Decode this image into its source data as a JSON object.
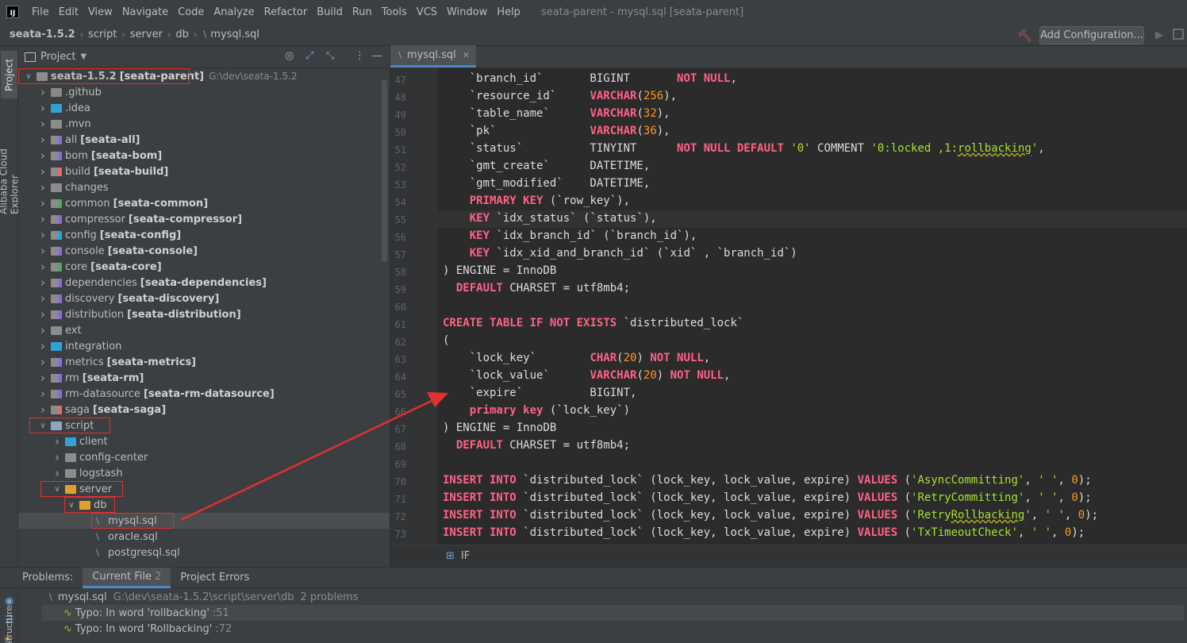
{
  "menubar": {
    "items": [
      "File",
      "Edit",
      "View",
      "Navigate",
      "Code",
      "Analyze",
      "Refactor",
      "Build",
      "Run",
      "Tools",
      "VCS",
      "Window",
      "Help"
    ],
    "window_title": "seata-parent - mysql.sql [seata-parent]"
  },
  "navbar": {
    "breadcrumbs": [
      "seata-1.5.2",
      "script",
      "server",
      "db",
      "mysql.sql"
    ],
    "add_config_label": "Add Configuration..."
  },
  "left_strip": {
    "tabs": [
      "Project",
      "Alibaba Cloud Explorer"
    ]
  },
  "project_panel": {
    "title": "Project",
    "tree": [
      {
        "depth": 0,
        "arrow": "down",
        "icon": "folder",
        "name": "seata-1.5.2",
        "module": "[seata-parent]",
        "hint": "G:\\dev\\seata-1.5.2"
      },
      {
        "depth": 1,
        "arrow": "right",
        "icon": "folder",
        "name": ".github"
      },
      {
        "depth": 1,
        "arrow": "right",
        "icon": "folder",
        "name": ".idea"
      },
      {
        "depth": 1,
        "arrow": "right",
        "icon": "folder",
        "name": ".mvn"
      },
      {
        "depth": 1,
        "arrow": "right",
        "icon": "module",
        "name": "all",
        "module": "[seata-all]"
      },
      {
        "depth": 1,
        "arrow": "right",
        "icon": "module",
        "name": "bom",
        "module": "[seata-bom]"
      },
      {
        "depth": 1,
        "arrow": "right",
        "icon": "module",
        "name": "build",
        "module": "[seata-build]"
      },
      {
        "depth": 1,
        "arrow": "right",
        "icon": "folder",
        "name": "changes"
      },
      {
        "depth": 1,
        "arrow": "right",
        "icon": "module",
        "name": "common",
        "module": "[seata-common]"
      },
      {
        "depth": 1,
        "arrow": "right",
        "icon": "module",
        "name": "compressor",
        "module": "[seata-compressor]"
      },
      {
        "depth": 1,
        "arrow": "right",
        "icon": "module",
        "name": "config",
        "module": "[seata-config]"
      },
      {
        "depth": 1,
        "arrow": "right",
        "icon": "module",
        "name": "console",
        "module": "[seata-console]"
      },
      {
        "depth": 1,
        "arrow": "right",
        "icon": "module",
        "name": "core",
        "module": "[seata-core]"
      },
      {
        "depth": 1,
        "arrow": "right",
        "icon": "module",
        "name": "dependencies",
        "module": "[seata-dependencies]"
      },
      {
        "depth": 1,
        "arrow": "right",
        "icon": "module",
        "name": "discovery",
        "module": "[seata-discovery]"
      },
      {
        "depth": 1,
        "arrow": "right",
        "icon": "module",
        "name": "distribution",
        "module": "[seata-distribution]"
      },
      {
        "depth": 1,
        "arrow": "right",
        "icon": "folder",
        "name": "ext"
      },
      {
        "depth": 1,
        "arrow": "right",
        "icon": "folder",
        "name": "integration"
      },
      {
        "depth": 1,
        "arrow": "right",
        "icon": "module",
        "name": "metrics",
        "module": "[seata-metrics]"
      },
      {
        "depth": 1,
        "arrow": "right",
        "icon": "module",
        "name": "rm",
        "module": "[seata-rm]"
      },
      {
        "depth": 1,
        "arrow": "right",
        "icon": "module",
        "name": "rm-datasource",
        "module": "[seata-rm-datasource]"
      },
      {
        "depth": 1,
        "arrow": "right",
        "icon": "module",
        "name": "saga",
        "module": "[seata-saga]"
      },
      {
        "depth": 1,
        "arrow": "down",
        "icon": "folder",
        "name": "script"
      },
      {
        "depth": 2,
        "arrow": "right",
        "icon": "folder",
        "name": "client"
      },
      {
        "depth": 2,
        "arrow": "right",
        "icon": "folder",
        "name": "config-center"
      },
      {
        "depth": 2,
        "arrow": "right",
        "icon": "folder",
        "name": "logstash"
      },
      {
        "depth": 2,
        "arrow": "down",
        "icon": "folder",
        "name": "server"
      },
      {
        "depth": 3,
        "arrow": "down",
        "icon": "folder",
        "name": "db"
      },
      {
        "depth": 4,
        "arrow": "",
        "icon": "sql",
        "name": "mysql.sql",
        "selected": true
      },
      {
        "depth": 4,
        "arrow": "",
        "icon": "sql",
        "name": "oracle.sql"
      },
      {
        "depth": 4,
        "arrow": "",
        "icon": "sql",
        "name": "postgresql.sql"
      }
    ]
  },
  "editor": {
    "tab_label": "mysql.sql",
    "footer_label": "IF",
    "lines": [
      {
        "n": "47",
        "t": [
          [
            "    `branch_id`       BIGINT       ",
            ""
          ],
          [
            "NOT NULL",
            "kw"
          ],
          [
            ",",
            ""
          ]
        ]
      },
      {
        "n": "48",
        "t": [
          [
            "    `resource_id`     ",
            ""
          ],
          [
            "VARCHAR",
            "kw"
          ],
          [
            "(",
            ""
          ],
          [
            "256",
            "num"
          ],
          [
            "),",
            ""
          ]
        ]
      },
      {
        "n": "49",
        "t": [
          [
            "    `table_name`      ",
            ""
          ],
          [
            "VARCHAR",
            "kw"
          ],
          [
            "(",
            ""
          ],
          [
            "32",
            "num"
          ],
          [
            "),",
            ""
          ]
        ]
      },
      {
        "n": "50",
        "t": [
          [
            "    `pk`              ",
            ""
          ],
          [
            "VARCHAR",
            "kw"
          ],
          [
            "(",
            ""
          ],
          [
            "36",
            "num"
          ],
          [
            "),",
            ""
          ]
        ]
      },
      {
        "n": "51",
        "t": [
          [
            "    `status`          TINYINT      ",
            ""
          ],
          [
            "NOT NULL DEFAULT",
            "kw"
          ],
          [
            " ",
            ""
          ],
          [
            "'0'",
            "str"
          ],
          [
            " COMMENT ",
            ""
          ],
          [
            "'0:locked ,1:",
            "str"
          ],
          [
            "rollbacking",
            "str typo"
          ],
          [
            "'",
            "str"
          ],
          [
            ",",
            ""
          ]
        ]
      },
      {
        "n": "52",
        "t": [
          [
            "    `gmt_create`      DATETIME,",
            ""
          ]
        ]
      },
      {
        "n": "53",
        "t": [
          [
            "    `gmt_modified`    DATETIME,",
            ""
          ]
        ]
      },
      {
        "n": "54",
        "t": [
          [
            "    ",
            ""
          ],
          [
            "PRIMARY KEY",
            "kw"
          ],
          [
            " (`row_key`),",
            ""
          ]
        ]
      },
      {
        "n": "55",
        "t": [
          [
            "    ",
            ""
          ],
          [
            "KEY",
            "kw"
          ],
          [
            " `idx_status` (`status`),",
            ""
          ]
        ]
      },
      {
        "n": "56",
        "t": [
          [
            "    ",
            ""
          ],
          [
            "KEY",
            "kw"
          ],
          [
            " `idx_branch_id` (`branch_id`),",
            ""
          ]
        ]
      },
      {
        "n": "57",
        "t": [
          [
            "    ",
            ""
          ],
          [
            "KEY",
            "kw"
          ],
          [
            " `idx_xid_and_branch_id` (`xid` , `branch_id`)",
            ""
          ]
        ]
      },
      {
        "n": "58",
        "t": [
          [
            ") ENGINE = InnoDB",
            ""
          ]
        ]
      },
      {
        "n": "59",
        "t": [
          [
            "  ",
            ""
          ],
          [
            "DEFAULT",
            "kw"
          ],
          [
            " CHARSET = utf8mb4;",
            ""
          ]
        ]
      },
      {
        "n": "60",
        "t": [
          [
            "",
            ""
          ]
        ]
      },
      {
        "n": "61",
        "t": [
          [
            "CREATE TABLE",
            "kw"
          ],
          [
            " ",
            ""
          ],
          [
            "IF",
            "kw"
          ],
          [
            " ",
            ""
          ],
          [
            "NOT EXISTS",
            "kw"
          ],
          [
            " `distributed_lock`",
            ""
          ]
        ]
      },
      {
        "n": "62",
        "t": [
          [
            "(",
            ""
          ]
        ]
      },
      {
        "n": "63",
        "t": [
          [
            "    `lock_key`        ",
            ""
          ],
          [
            "CHAR",
            "kw"
          ],
          [
            "(",
            ""
          ],
          [
            "20",
            "num"
          ],
          [
            ") ",
            ""
          ],
          [
            "NOT NULL",
            "kw"
          ],
          [
            ",",
            ""
          ]
        ]
      },
      {
        "n": "64",
        "t": [
          [
            "    `lock_value`      ",
            ""
          ],
          [
            "VARCHAR",
            "kw"
          ],
          [
            "(",
            ""
          ],
          [
            "20",
            "num"
          ],
          [
            ") ",
            ""
          ],
          [
            "NOT NULL",
            "kw"
          ],
          [
            ",",
            ""
          ]
        ]
      },
      {
        "n": "65",
        "t": [
          [
            "    `expire`          BIGINT,",
            ""
          ]
        ]
      },
      {
        "n": "66",
        "t": [
          [
            "    ",
            ""
          ],
          [
            "primary key",
            "kw"
          ],
          [
            " (`lock_key`)",
            ""
          ]
        ]
      },
      {
        "n": "67",
        "t": [
          [
            ") ENGINE = InnoDB",
            ""
          ]
        ]
      },
      {
        "n": "68",
        "t": [
          [
            "  ",
            ""
          ],
          [
            "DEFAULT",
            "kw"
          ],
          [
            " CHARSET = utf8mb4;",
            ""
          ]
        ]
      },
      {
        "n": "69",
        "t": [
          [
            "",
            ""
          ]
        ]
      },
      {
        "n": "70",
        "t": [
          [
            "INSERT INTO",
            "kw"
          ],
          [
            " `distributed_lock` (lock_key, lock_value, expire) ",
            ""
          ],
          [
            "VALUES",
            "kw"
          ],
          [
            " (",
            ""
          ],
          [
            "'AsyncCommitting'",
            "str"
          ],
          [
            ", ",
            ""
          ],
          [
            "' '",
            "str"
          ],
          [
            ", ",
            ""
          ],
          [
            "0",
            "num"
          ],
          [
            ");",
            ""
          ]
        ]
      },
      {
        "n": "71",
        "t": [
          [
            "INSERT INTO",
            "kw"
          ],
          [
            " `distributed_lock` (lock_key, lock_value, expire) ",
            ""
          ],
          [
            "VALUES",
            "kw"
          ],
          [
            " (",
            ""
          ],
          [
            "'RetryCommitting'",
            "str"
          ],
          [
            ", ",
            ""
          ],
          [
            "' '",
            "str"
          ],
          [
            ", ",
            ""
          ],
          [
            "0",
            "num"
          ],
          [
            ");",
            ""
          ]
        ]
      },
      {
        "n": "72",
        "t": [
          [
            "INSERT INTO",
            "kw"
          ],
          [
            " `distributed_lock` (lock_key, lock_value, expire) ",
            ""
          ],
          [
            "VALUES",
            "kw"
          ],
          [
            " (",
            ""
          ],
          [
            "'Retry",
            "str"
          ],
          [
            "Rollbacking",
            "str typo"
          ],
          [
            "'",
            "str"
          ],
          [
            ", ",
            ""
          ],
          [
            "' '",
            "str"
          ],
          [
            ", ",
            ""
          ],
          [
            "0",
            "num"
          ],
          [
            ");",
            ""
          ]
        ]
      },
      {
        "n": "73",
        "t": [
          [
            "INSERT INTO",
            "kw"
          ],
          [
            " `distributed_lock` (lock_key, lock_value, expire) ",
            ""
          ],
          [
            "VALUES",
            "kw"
          ],
          [
            " (",
            ""
          ],
          [
            "'TxTimeoutCheck'",
            "str"
          ],
          [
            ", ",
            ""
          ],
          [
            "' '",
            "str"
          ],
          [
            ", ",
            ""
          ],
          [
            "0",
            "num"
          ],
          [
            ");",
            ""
          ]
        ]
      }
    ]
  },
  "problems": {
    "label": "Problems:",
    "tabs": [
      {
        "label": "Current File",
        "count": "2"
      },
      {
        "label": "Project Errors",
        "count": ""
      }
    ],
    "file": {
      "name": "mysql.sql",
      "path": "G:\\dev\\seata-1.5.2\\script\\server\\db",
      "summary": "2 problems"
    },
    "items": [
      {
        "text": "Typo: In word 'rollbacking'",
        "loc": ":51"
      },
      {
        "text": "Typo: In word 'Rollbacking'",
        "loc": ":72"
      }
    ],
    "side_label": "Structure"
  },
  "colors": {
    "accent": "#4a88c7",
    "keyword": "#ff6188",
    "string": "#a6e22e",
    "number": "#fd971f",
    "annotation_red": "#e03030"
  }
}
